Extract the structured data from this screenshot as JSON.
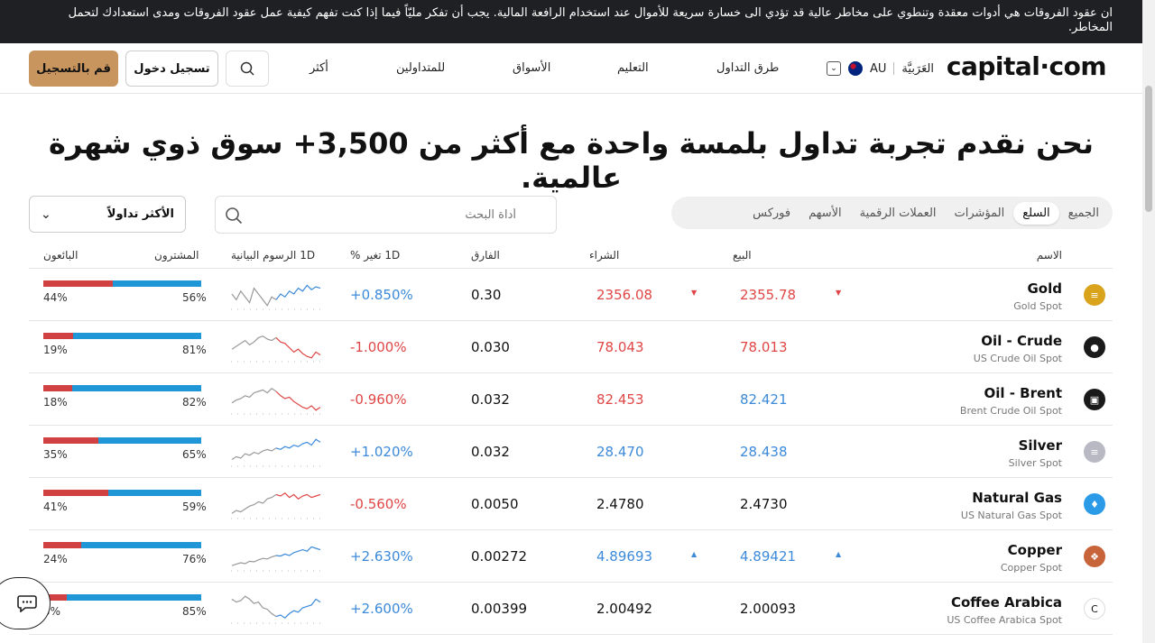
{
  "banner": {
    "text": "ان عقود الفروقات هي أدوات معقدة وتنطوي على مخاطر عالية قد تؤدي الى خسارة سريعة للأموال عند استخدام الرافعة المالية. يجب أن تفكر مليّاً فيما إذا كنت تفهم كيفية عمل عقود الفروقات ومدى استعدادك لتحمل المخاطر."
  },
  "header": {
    "logo": "capital·com",
    "region": "AU",
    "language": "العَرَبيَّة",
    "nav": [
      "طرق التداول",
      "التعليم",
      "الأسواق",
      "للمتداولين",
      "أكثر"
    ],
    "login": "تسجيل دخول",
    "signup": "قم بالتسجيل"
  },
  "headline": "نحن نقدم تجربة تداول بلمسة واحدة مع أكثر من 3,500+ سوق ذوي شهرة عالمية.",
  "filters": {
    "tabs": [
      "الجميع",
      "السلع",
      "المؤشرات",
      "العملات الرقمية",
      "الأسهم",
      "فوركس"
    ],
    "active_tab": "السلع",
    "search_placeholder": "أداة البحث",
    "sort": "الأكثر تداولاً"
  },
  "table": {
    "headers": {
      "name": "الاسم",
      "sell": "البيع",
      "buy": "الشراء",
      "spread": "الفارق",
      "change": "1D تغير %",
      "chart": "1D الرسوم البيانية",
      "buyers": "المشترون",
      "sellers": "البائعون"
    },
    "rows": [
      {
        "name": "Gold",
        "sub": "Gold Spot",
        "sell": "2355.78",
        "buy": "2356.08",
        "spread": "0.30",
        "change": "+0.850%",
        "buyers": "56%",
        "sellers": "44%",
        "buyers_ratio": 0.56,
        "color": "red",
        "dir": "down",
        "change_dir": "up",
        "icon": "gold-bars-icon",
        "icon_color": "#d9a31c",
        "icon_glyph": "≡"
      },
      {
        "name": "Oil - Crude",
        "sub": "US Crude Oil Spot",
        "sell": "78.013",
        "buy": "78.043",
        "spread": "0.030",
        "change": "-1.000%",
        "buyers": "81%",
        "sellers": "19%",
        "buyers_ratio": 0.81,
        "color": "red",
        "dir": "",
        "change_dir": "down",
        "icon": "oil-drop-icon",
        "icon_color": "#1a1a1a",
        "icon_glyph": "●"
      },
      {
        "name": "Oil - Brent",
        "sub": "Brent Crude Oil Spot",
        "sell": "82.421",
        "buy": "82.453",
        "spread": "0.032",
        "change": "-0.960%",
        "buyers": "82%",
        "sellers": "18%",
        "buyers_ratio": 0.82,
        "color": "blue-red",
        "dir": "",
        "change_dir": "down",
        "icon": "oil-barrel-icon",
        "icon_color": "#1a1a1a",
        "icon_glyph": "▣"
      },
      {
        "name": "Silver",
        "sub": "Silver Spot",
        "sell": "28.438",
        "buy": "28.470",
        "spread": "0.032",
        "change": "+1.020%",
        "buyers": "65%",
        "sellers": "35%",
        "buyers_ratio": 0.65,
        "color": "blue",
        "dir": "",
        "change_dir": "up",
        "icon": "silver-bars-icon",
        "icon_color": "#b9b9c3",
        "icon_glyph": "≡"
      },
      {
        "name": "Natural Gas",
        "sub": "US Natural Gas Spot",
        "sell": "2.4730",
        "buy": "2.4780",
        "spread": "0.0050",
        "change": "-0.560%",
        "buyers": "59%",
        "sellers": "41%",
        "buyers_ratio": 0.59,
        "color": "dark",
        "dir": "",
        "change_dir": "down",
        "icon": "gas-flame-icon",
        "icon_color": "#2b9be8",
        "icon_glyph": "♦"
      },
      {
        "name": "Copper",
        "sub": "Copper Spot",
        "sell": "4.89421",
        "buy": "4.89693",
        "spread": "0.00272",
        "change": "+2.630%",
        "buyers": "76%",
        "sellers": "24%",
        "buyers_ratio": 0.76,
        "color": "blue",
        "dir": "up",
        "change_dir": "up",
        "icon": "copper-icon",
        "icon_color": "#c8643a",
        "icon_glyph": "❖"
      },
      {
        "name": "Coffee Arabica",
        "sub": "US Coffee Arabica Spot",
        "sell": "2.00093",
        "buy": "2.00492",
        "spread": "0.00399",
        "change": "+2.600%",
        "buyers": "85%",
        "sellers": "5%",
        "buyers_ratio": 0.85,
        "color": "dark",
        "dir": "",
        "change_dir": "up",
        "icon": "coffee-icon",
        "icon_color": "#ffffff",
        "icon_glyph": "C"
      }
    ]
  }
}
